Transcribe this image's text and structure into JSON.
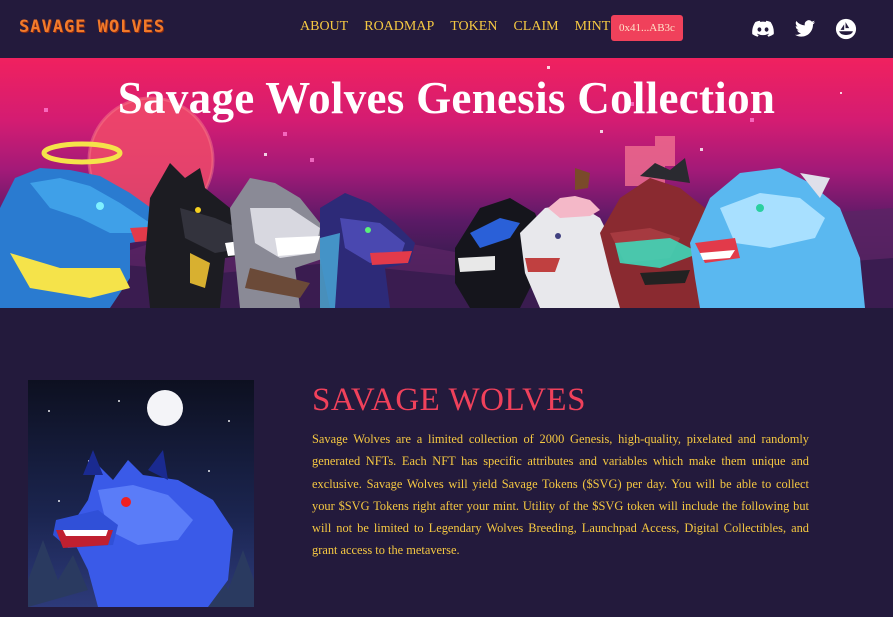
{
  "nav": {
    "logo": "SAVAGE WOLVES",
    "links": [
      "ABOUT",
      "ROADMAP",
      "TOKEN",
      "CLAIM",
      "MINT"
    ],
    "wallet_label": "0x41...AB3c",
    "social_icons": [
      "discord-icon",
      "twitter-icon",
      "opensea-icon"
    ]
  },
  "hero": {
    "title": "Savage Wolves Genesis Collection"
  },
  "about": {
    "title": "SAVAGE WOLVES",
    "body": "Savage Wolves are a limited collection of 2000 Genesis, high-quality, pixelated and randomly generated NFTs. Each NFT has specific attributes and variables which make them unique and exclusive. Savage Wolves will yield Savage Tokens ($SVG) per day. You will be able to collect your $SVG Tokens right after your mint. Utility of the $SVG token will include the following but will not be limited to Legendary Wolves Breeding, Launchpad Access, Digital Collectibles, and grant access to the metaverse."
  },
  "colors": {
    "background": "#231a3c",
    "accent_red": "#f0415b",
    "gold_text": "#f5c842",
    "logo_orange": "#f27a2a"
  }
}
